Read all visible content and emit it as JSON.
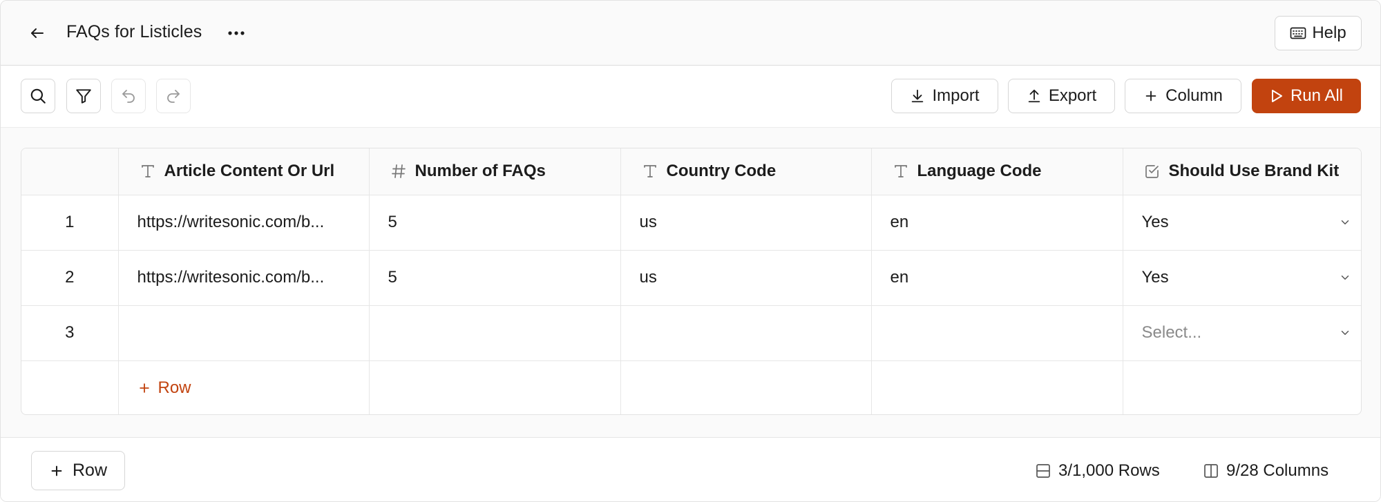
{
  "header": {
    "title": "FAQs for Listicles",
    "help_label": "Help"
  },
  "toolbar": {
    "import_label": "Import",
    "export_label": "Export",
    "column_label": "Column",
    "run_all_label": "Run All"
  },
  "table": {
    "columns": [
      {
        "type_icon": "text-type-icon",
        "label": "Article Content Or Url"
      },
      {
        "type_icon": "hash-icon",
        "label": "Number of FAQs"
      },
      {
        "type_icon": "text-type-icon",
        "label": "Country Code"
      },
      {
        "type_icon": "text-type-icon",
        "label": "Language Code"
      },
      {
        "type_icon": "checkbox-icon",
        "label": "Should Use Brand Kit"
      }
    ],
    "rows": [
      {
        "index": "1",
        "article": "https://writesonic.com/b...",
        "faqs": "5",
        "country": "us",
        "language": "en",
        "brand_kit": "Yes"
      },
      {
        "index": "2",
        "article": "https://writesonic.com/b...",
        "faqs": "5",
        "country": "us",
        "language": "en",
        "brand_kit": "Yes"
      },
      {
        "index": "3",
        "article": "",
        "faqs": "",
        "country": "",
        "language": "",
        "brand_kit": "Select..."
      }
    ],
    "add_row_label": "Row"
  },
  "footer": {
    "add_row_label": "Row",
    "rows_stat": "3/1,000 Rows",
    "columns_stat": "9/28 Columns"
  },
  "colors": {
    "accent": "#c2430f",
    "border": "#e2e2e2",
    "header_bg": "#fafafa"
  }
}
